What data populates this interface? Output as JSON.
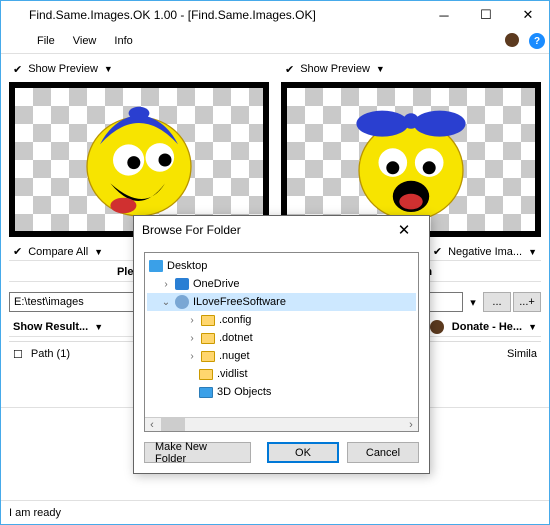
{
  "window": {
    "title": "Find.Same.Images.OK 1.00 - [Find.Same.Images.OK]"
  },
  "menu": {
    "file": "File",
    "view": "View",
    "info": "Info"
  },
  "preview": {
    "left_label": "Show Preview",
    "right_label": "Show Preview"
  },
  "row2": {
    "compare": "Compare All",
    "negative": "Negative Ima..."
  },
  "row3": {
    "please": "Please s",
    "tbutton": "t Button"
  },
  "path": {
    "value": "E:\\test\\images",
    "browse": "...",
    "add": "...+"
  },
  "row4": {
    "results": "Show Result...",
    "donate": "Donate - He..."
  },
  "list": {
    "path_hdr": "Path (1)",
    "simila": "Simila"
  },
  "status": "I am ready",
  "dialog": {
    "title": "Browse For Folder",
    "tree": {
      "root": "Desktop",
      "items": [
        {
          "label": "OneDrive",
          "type": "onedrive",
          "depth": 1,
          "expand": ">"
        },
        {
          "label": "ILoveFreeSoftware",
          "type": "user",
          "depth": 1,
          "expand": "v",
          "selected": true
        },
        {
          "label": ".config",
          "type": "folder",
          "depth": 2,
          "expand": ">"
        },
        {
          "label": ".dotnet",
          "type": "folder",
          "depth": 2,
          "expand": ">"
        },
        {
          "label": ".nuget",
          "type": "folder",
          "depth": 2,
          "expand": ">"
        },
        {
          "label": ".vidlist",
          "type": "folder",
          "depth": 2,
          "expand": ""
        },
        {
          "label": "3D Objects",
          "type": "cube",
          "depth": 2,
          "expand": ""
        }
      ]
    },
    "make_new": "Make New Folder",
    "ok": "OK",
    "cancel": "Cancel"
  }
}
